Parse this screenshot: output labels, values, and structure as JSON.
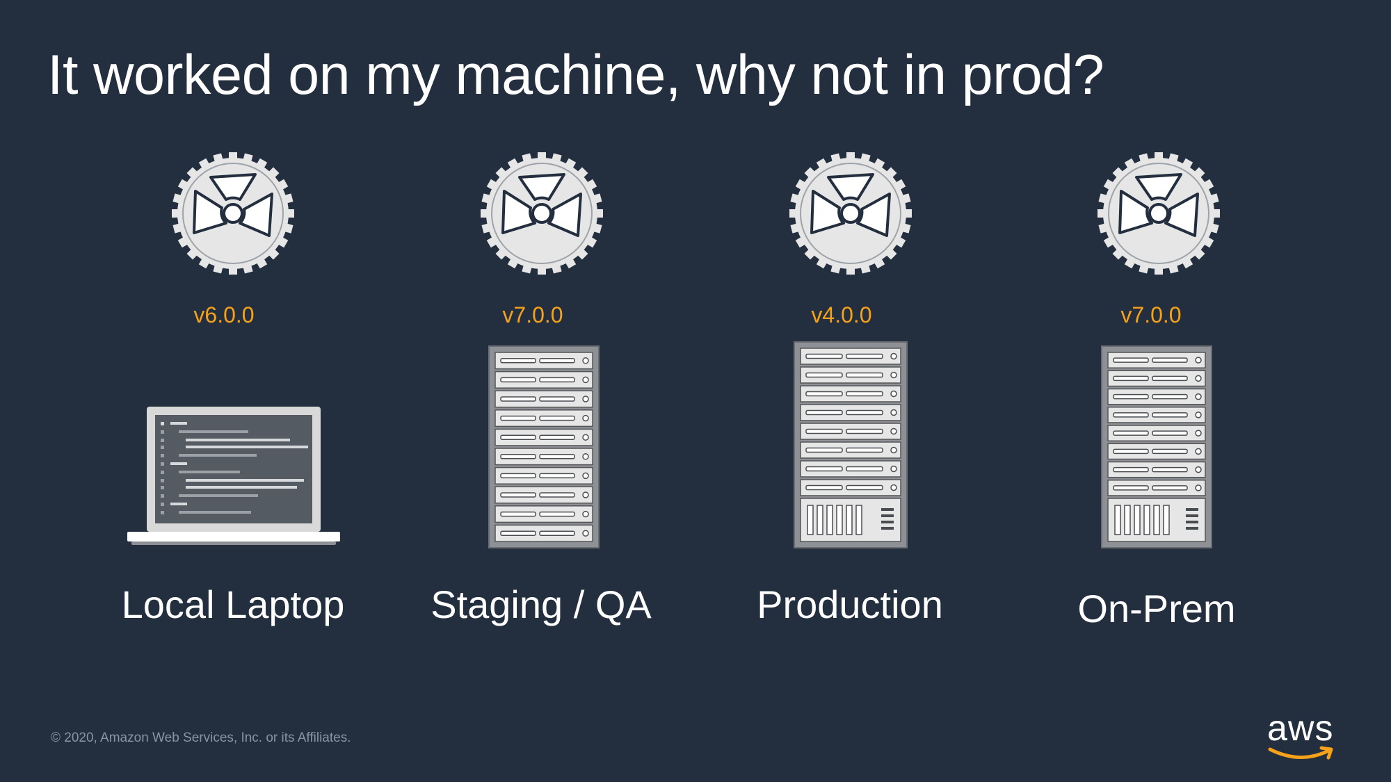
{
  "slide": {
    "title": "It worked on my machine, why not in prod?",
    "footer": "© 2020, Amazon Web Services, Inc. or its Affiliates.",
    "logo_text": "aws"
  },
  "colors": {
    "background": "#232f3e",
    "version_accent": "#f7a21b",
    "logo_smile": "#f7a21b"
  },
  "environments": [
    {
      "label": "Local Laptop",
      "version": "v6.0.0",
      "device_icon": "laptop-icon",
      "runtime_icon": "gear-icon"
    },
    {
      "label": "Staging / QA",
      "version": "v7.0.0",
      "device_icon": "server-rack-icon",
      "runtime_icon": "gear-icon"
    },
    {
      "label": "Production",
      "version": "v4.0.0",
      "device_icon": "server-rack-icon",
      "runtime_icon": "gear-icon"
    },
    {
      "label": "On-Prem",
      "version": "v7.0.0",
      "device_icon": "server-rack-icon",
      "runtime_icon": "gear-icon"
    }
  ]
}
